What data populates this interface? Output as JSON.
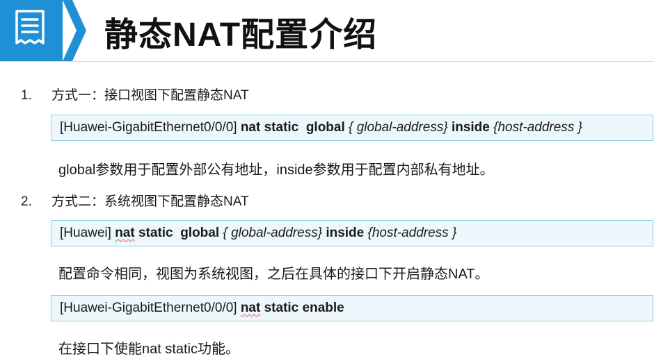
{
  "header": {
    "title": "静态NAT配置介绍",
    "accent_color": "#1f8fd6",
    "icon": "document-icon"
  },
  "method1": {
    "number": "1.",
    "heading": "方式一：接口视图下配置静态NAT",
    "cmd_prompt": "[Huawei-GigabitEthernet0/0/0]",
    "cmd_nat": "nat",
    "cmd_static": "static",
    "cmd_global": "global",
    "cmd_brace_open": "{",
    "cmd_global_addr": "global-address}",
    "cmd_inside": "inside",
    "cmd_host_addr": "{host-address }",
    "description": "global参数用于配置外部公有地址，inside参数用于配置内部私有地址。"
  },
  "method2": {
    "number": "2.",
    "heading": "方式二：系统视图下配置静态NAT",
    "cmd_prompt": "[Huawei]",
    "cmd_nat": "nat",
    "cmd_static": "static",
    "cmd_global": "global",
    "cmd_brace_open": "{",
    "cmd_global_addr": "global-address}",
    "cmd_inside": "inside",
    "cmd_host_addr": "{host-address }",
    "description": "配置命令相同，视图为系统视图，之后在具体的接口下开启静态NAT。",
    "enable_prompt": "[Huawei-GigabitEthernet0/0/0]",
    "enable_nat": "nat",
    "enable_rest": "static enable",
    "enable_description": "在接口下使能nat static功能。"
  }
}
